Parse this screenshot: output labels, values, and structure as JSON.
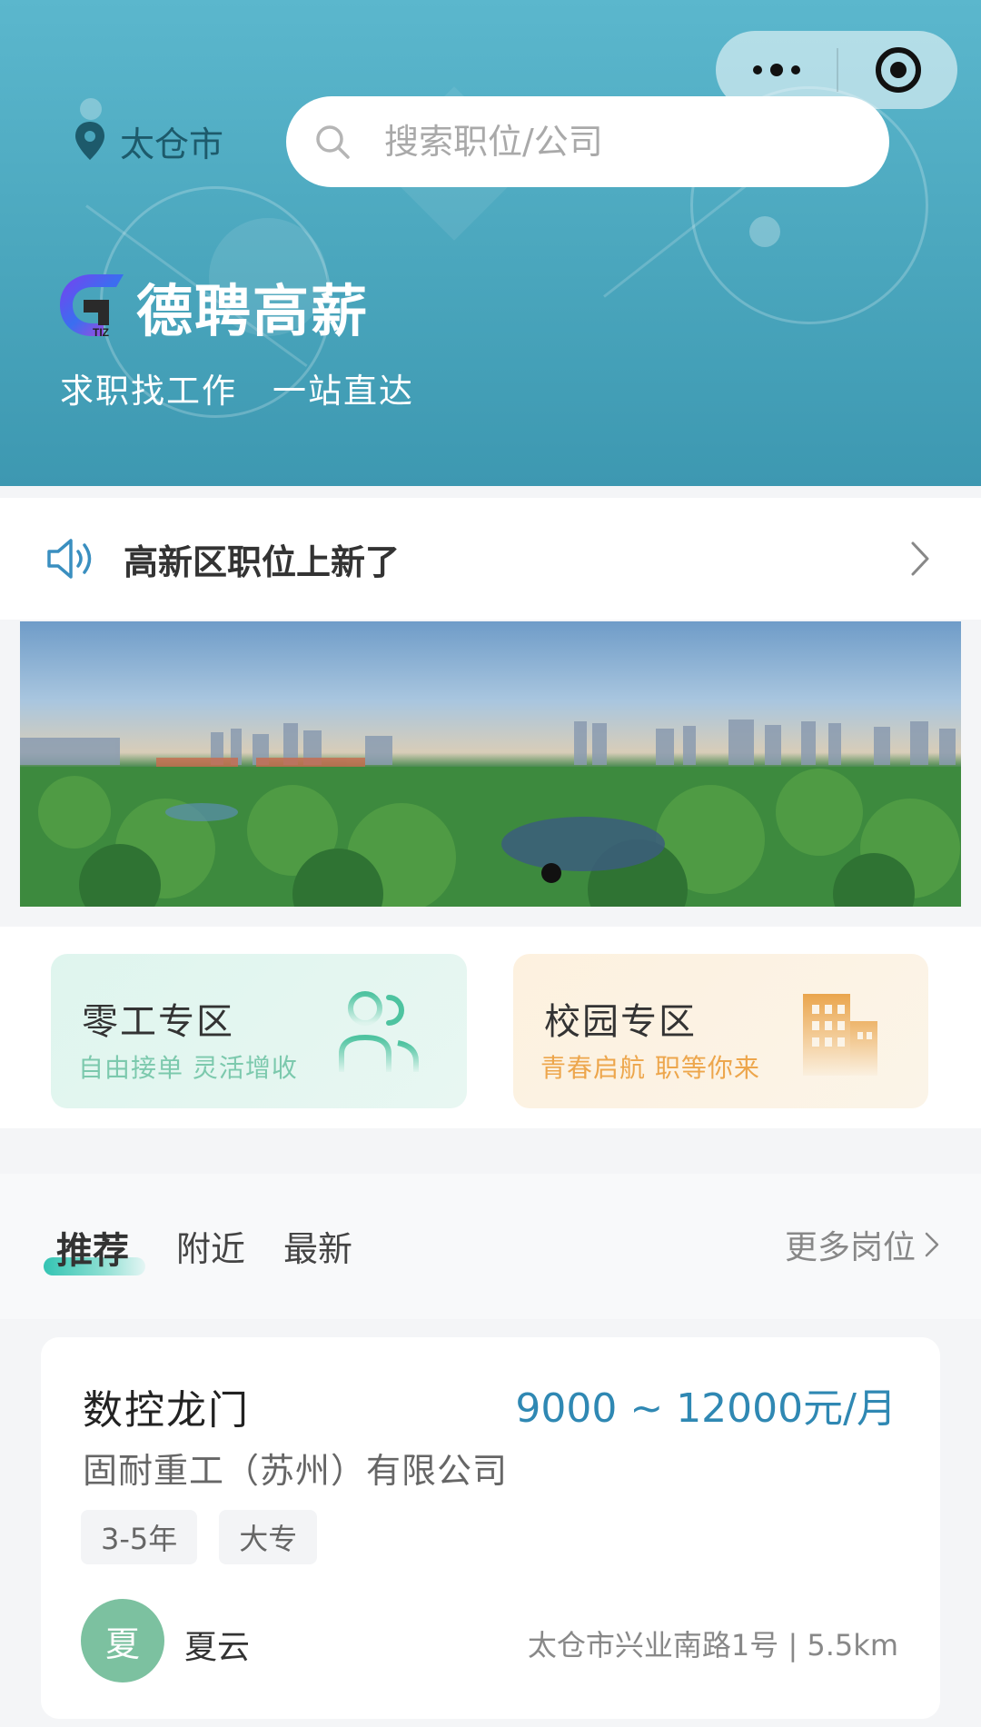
{
  "header": {
    "city": "太仓市",
    "search_placeholder": "搜索职位/公司",
    "brand_name": "德聘高薪",
    "logo_text": "TIZ",
    "slogan": "求职找工作　一站直达",
    "gradient_colors": [
      "#5bb7cd",
      "#3d98b1"
    ]
  },
  "capsule": {
    "more_icon": "more-dots-icon",
    "close_icon": "target-icon"
  },
  "notice": {
    "text": "高新区职位上新了",
    "icon": "speaker-icon"
  },
  "banner": {
    "image": "city-park-panorama",
    "active_dot": 1
  },
  "zones": [
    {
      "title": "零工专区",
      "subtitle": "自由接单  灵活增收",
      "icon": "people-icon",
      "accent": "#7cc9ad"
    },
    {
      "title": "校园专区",
      "subtitle": "青春启航  职等你来",
      "icon": "building-icon",
      "accent": "#eda64c"
    }
  ],
  "tabs": {
    "items": [
      "推荐",
      "附近",
      "最新"
    ],
    "active": "推荐",
    "more_label": "更多岗位"
  },
  "job_card": {
    "title": "数控龙门",
    "salary": "9000 ~ 12000元/月",
    "company": "固耐重工（苏州）有限公司",
    "tags": [
      "3-5年",
      "大专"
    ],
    "avatar_char": "夏",
    "recruiter": "夏云",
    "address": "太仓市兴业南路1号 | 5.5km",
    "salary_color": "#2f88b3"
  }
}
